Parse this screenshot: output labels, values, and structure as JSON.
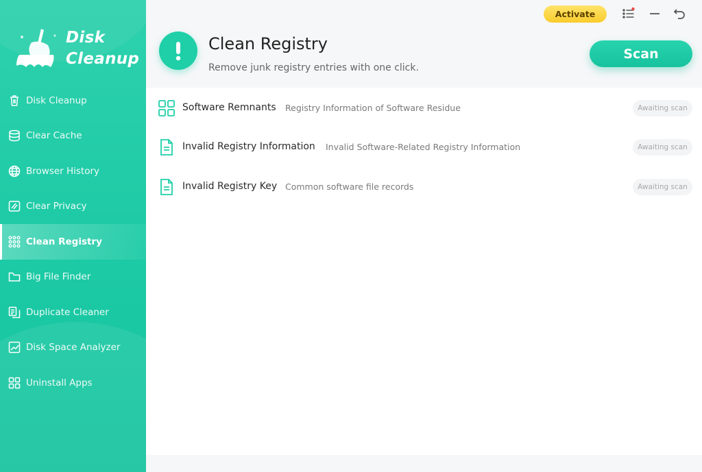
{
  "app": {
    "brand_line1": "Disk",
    "brand_line2": "Cleanup",
    "accent_color": "#1ecfa8"
  },
  "sidebar": {
    "items": [
      {
        "label": "Disk Cleanup",
        "icon": "trash-icon"
      },
      {
        "label": "Clear Cache",
        "icon": "database-icon"
      },
      {
        "label": "Browser History",
        "icon": "globe-icon"
      },
      {
        "label": "Clear Privacy",
        "icon": "privacy-icon"
      },
      {
        "label": "Clean Registry",
        "icon": "registry-grid-icon",
        "active": true
      },
      {
        "label": "Big File Finder",
        "icon": "folder-icon"
      },
      {
        "label": "Duplicate Cleaner",
        "icon": "duplicate-icon"
      },
      {
        "label": "Disk Space Analyzer",
        "icon": "chart-icon"
      },
      {
        "label": "Uninstall Apps",
        "icon": "apps-icon"
      }
    ]
  },
  "topbar": {
    "activate_label": "Activate",
    "icons": [
      "menu-list-icon",
      "minimize-icon",
      "back-icon"
    ]
  },
  "header": {
    "title": "Clean Registry",
    "subtitle": "Remove junk registry entries with one click.",
    "icon": "exclamation-icon",
    "scan_label": "Scan"
  },
  "items": [
    {
      "name": "Software Remnants",
      "description": "Registry Information of Software Residue",
      "status": "Awaiting scan",
      "icon": "grid-icon"
    },
    {
      "name": "Invalid Registry Information",
      "description": "Invalid Software-Related Registry Information",
      "status": "Awaiting scan",
      "icon": "document-icon"
    },
    {
      "name": "Invalid Registry Key",
      "description": "Common software file records",
      "status": "Awaiting scan",
      "icon": "document-icon"
    }
  ]
}
